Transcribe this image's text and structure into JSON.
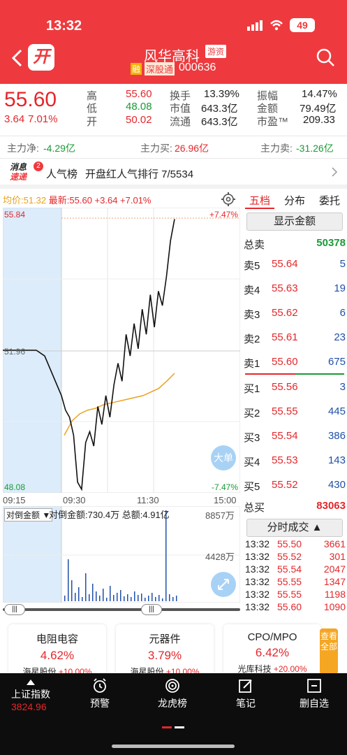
{
  "status": {
    "time": "13:32",
    "battery": "49"
  },
  "header": {
    "logo": "开",
    "name": "风华高科",
    "tag": "游资",
    "rong": "融",
    "market": "深股通",
    "code": "000636"
  },
  "quote": {
    "price": "55.60",
    "change": "3.64",
    "pct": "7.01%",
    "labels": {
      "high": "高",
      "low": "低",
      "open": "开",
      "turnover": "换手",
      "mcap": "市值",
      "float": "流通",
      "amp": "振幅",
      "amount": "金额",
      "pe": "市盈™"
    },
    "values": {
      "high": "55.60",
      "low": "48.08",
      "open": "50.02",
      "turnover": "13.39%",
      "mcap": "643.3亿",
      "float": "643.3亿",
      "amp": "14.47%",
      "amount": "79.49亿",
      "pe": "209.33"
    }
  },
  "flow": {
    "net_label": "主力净:",
    "net": "-4.29亿",
    "buy_label": "主力买:",
    "buy": "26.96亿",
    "sell_label": "主力卖:",
    "sell": "-31.26亿"
  },
  "news": {
    "badge1": "消息",
    "badge2": "速递",
    "count": "2",
    "title": "人气榜",
    "text": "开盘红人气排行 7/5534"
  },
  "chart_header": {
    "avg": "均价:51.32",
    "latest": "最新:55.60 +3.64 +7.01%"
  },
  "chart_data": {
    "type": "line",
    "x": [
      "09:15",
      "09:30",
      "11:30",
      "15:00"
    ],
    "y_max": "55.84",
    "y_mid": "51.96",
    "y_min": "48.08",
    "pct_max": "+7.47%",
    "pct_min": "-7.47%",
    "ylim": [
      48.08,
      55.84
    ],
    "series": [
      {
        "values_price": [
          51.96,
          51.96,
          51.96,
          51.96,
          51.96,
          51.8,
          50.7,
          50.3,
          50.1,
          49.6,
          48.3,
          48.1,
          49.4,
          49.7,
          49.3,
          50.4,
          49.9,
          50.7,
          50.1,
          51.0,
          51.6,
          51.1,
          52.4,
          51.8,
          52.7,
          52.0,
          53.1,
          52.4,
          53.5,
          52.6,
          53.6,
          53.2,
          54.0,
          55.0,
          55.6
        ]
      },
      {
        "values_avg": [
          49.6,
          50.0,
          50.2,
          50.3,
          50.35,
          50.45,
          50.5,
          50.55,
          50.6,
          50.65,
          50.7,
          50.8,
          50.9,
          51.1,
          51.32
        ]
      }
    ],
    "time_labels": [
      "09:15",
      "09:30",
      "11:30",
      "15:00"
    ],
    "volume": {
      "selector": "对倒金额",
      "info": "对倒金额:730.4万 总额:4.91亿",
      "max": "8857万",
      "mid": "4428万"
    }
  },
  "tabs": [
    "五档",
    "分布",
    "委托"
  ],
  "orderbook": {
    "show_amount": "显示金额",
    "total_sell_label": "总卖",
    "total_sell": "50378",
    "asks": [
      {
        "l": "卖5",
        "p": "55.64",
        "v": "5"
      },
      {
        "l": "卖4",
        "p": "55.63",
        "v": "19"
      },
      {
        "l": "卖3",
        "p": "55.62",
        "v": "6"
      },
      {
        "l": "卖2",
        "p": "55.61",
        "v": "23"
      },
      {
        "l": "卖1",
        "p": "55.60",
        "v": "675"
      }
    ],
    "bids": [
      {
        "l": "买1",
        "p": "55.56",
        "v": "3"
      },
      {
        "l": "买2",
        "p": "55.55",
        "v": "445"
      },
      {
        "l": "买3",
        "p": "55.54",
        "v": "386"
      },
      {
        "l": "买4",
        "p": "55.53",
        "v": "143"
      },
      {
        "l": "买5",
        "p": "55.52",
        "v": "430"
      }
    ],
    "total_buy_label": "总买",
    "total_buy": "83063",
    "ticks_label": "分时成交 ▲",
    "ticks": [
      {
        "t": "13:32",
        "p": "55.50",
        "v": "3661"
      },
      {
        "t": "13:32",
        "p": "55.52",
        "v": "301"
      },
      {
        "t": "13:32",
        "p": "55.54",
        "v": "2047"
      },
      {
        "t": "13:32",
        "p": "55.55",
        "v": "1347"
      },
      {
        "t": "13:32",
        "p": "55.55",
        "v": "1198"
      },
      {
        "t": "13:32",
        "p": "55.60",
        "v": "1090"
      }
    ]
  },
  "float_buttons": {
    "big": "大单"
  },
  "sectors": [
    {
      "name": "电阻电容",
      "pct": "4.62%",
      "stock": "海星股份",
      "spct": "+10.00%"
    },
    {
      "name": "元器件",
      "pct": "3.79%",
      "stock": "海星股份",
      "spct": "+10.00%"
    },
    {
      "name": "CPO/MPO",
      "pct": "6.42%",
      "stock": "光库科技",
      "spct": "+20.00%"
    }
  ],
  "view_all": "查看全部",
  "nav": {
    "index_label": "上证指数",
    "index_value": "3824.96",
    "items": [
      "预警",
      "龙虎榜",
      "笔记",
      "删自选"
    ]
  }
}
